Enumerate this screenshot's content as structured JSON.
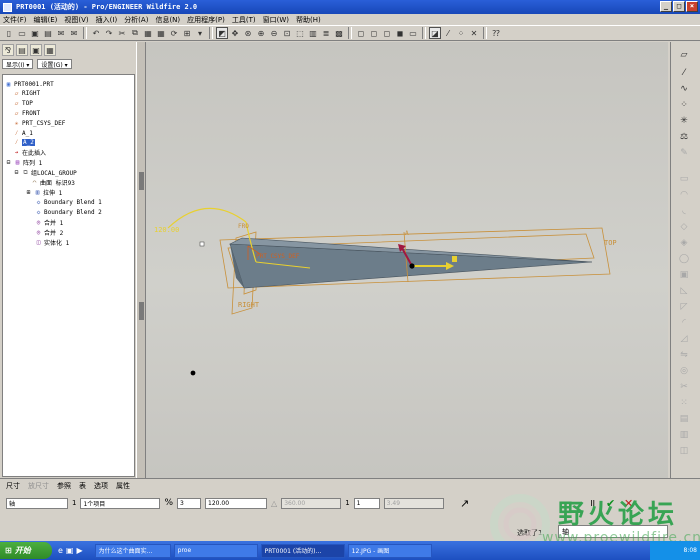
{
  "window": {
    "title": "PRT0001 (活动的) - Pro/ENGINEER Wildfire 2.0",
    "buttons": [
      "_",
      "□",
      "×"
    ]
  },
  "menu": [
    "文件(F)",
    "编辑(E)",
    "视图(V)",
    "插入(I)",
    "分析(A)",
    "信息(N)",
    "应用程序(P)",
    "工具(T)",
    "窗口(W)",
    "帮助(H)"
  ],
  "navigator": {
    "show_label": "显示(I) ▾",
    "settings_label": "设置(G) ▾"
  },
  "tree": {
    "items": [
      {
        "label": "PRT0001.PRT",
        "icon": "part-icon"
      },
      {
        "label": "RIGHT",
        "icon": "datum-plane-icon"
      },
      {
        "label": "TOP",
        "icon": "datum-plane-icon"
      },
      {
        "label": "FRONT",
        "icon": "datum-plane-icon"
      },
      {
        "label": "PRT_CSYS_DEF",
        "icon": "csys-icon"
      },
      {
        "label": "A_1",
        "icon": "datum-axis-icon"
      },
      {
        "label": "A_2",
        "icon": "datum-axis-icon"
      },
      {
        "label": "在此插入",
        "icon": "insert-arrow-icon"
      },
      {
        "label": "阵列 1",
        "icon": "pattern-icon"
      },
      {
        "label": "组LOCAL_GROUP",
        "icon": "group-icon"
      },
      {
        "label": "曲面 标识93",
        "icon": "surface-icon"
      },
      {
        "label": "拉伸 1",
        "icon": "extrude-icon"
      },
      {
        "label": "Boundary Blend 1",
        "icon": "boundary-blend-icon"
      },
      {
        "label": "Boundary Blend 2",
        "icon": "boundary-blend-icon"
      },
      {
        "label": "合并 1",
        "icon": "merge-icon"
      },
      {
        "label": "合并 2",
        "icon": "merge-icon"
      },
      {
        "label": "实体化 1",
        "icon": "solidify-icon"
      }
    ]
  },
  "viewport": {
    "angle_label": "120.00",
    "plane_top": "TOP",
    "plane_right": "RIGHT",
    "plane_front": "FRO",
    "csys_label": "PRT_CSYS_DEF",
    "axis_label": "A"
  },
  "dashboard": {
    "tabs": [
      "尺寸",
      "参照",
      "表",
      "选项",
      "属性"
    ],
    "disabled_tab": "放尺寸",
    "pattern_type": "轴",
    "item_count_prefix": "1",
    "items_value": "1个项目",
    "count1": "3",
    "angle1": "120.00",
    "angle2": "360.00",
    "count2": "1",
    "offset2": "3.49",
    "confirm_label": "✔",
    "cancel_label": "✕",
    "pause_label": "II"
  },
  "status": {
    "selection_text": "选取了1",
    "filter_value": "轴"
  },
  "taskbar": {
    "start_label": "开始",
    "items": [
      "为什么这个曲面实...",
      "proe",
      "PRT0001 (活动的)...",
      "12.JPG - 画图"
    ],
    "clock": "8:08"
  },
  "watermark": {
    "text": "野火论坛",
    "url": "www.proewildfire.cn"
  }
}
